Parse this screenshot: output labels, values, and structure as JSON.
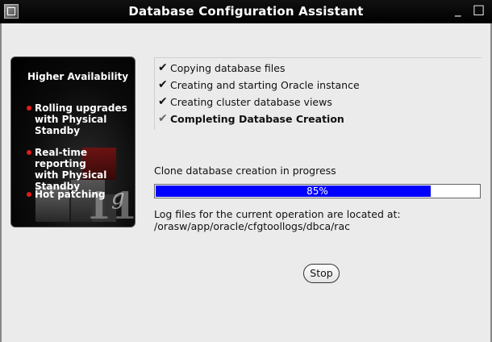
{
  "window": {
    "title": "Database Configuration Assistant",
    "minimize_glyph": "_",
    "maximize_glyph": "□"
  },
  "promo": {
    "heading": "Higher Availability",
    "items": [
      {
        "label": "Rolling upgrades\nwith Physical\nStandby"
      },
      {
        "label": "Real-time reporting\nwith Physical\nStandby"
      },
      {
        "label": "Hot patching"
      }
    ],
    "accent_color": "#e21b1b"
  },
  "steps": [
    {
      "label": "Copying database files",
      "status": "done",
      "icon": "check-icon",
      "mark": "✔"
    },
    {
      "label": "Creating and starting Oracle instance",
      "status": "done",
      "icon": "check-icon",
      "mark": "✔"
    },
    {
      "label": "Creating cluster database views",
      "status": "done",
      "icon": "check-icon",
      "mark": "✔"
    },
    {
      "label": "Completing Database Creation",
      "status": "in_progress",
      "icon": "pending-check-icon",
      "mark": "✔"
    }
  ],
  "progress": {
    "label": "Clone database creation in progress",
    "percent_text": "85%",
    "value": 0.85,
    "fill_color": "#0000ff"
  },
  "log": {
    "line1": "Log files for the current operation are located at:",
    "line2": "/orasw/app/oracle/cfgtoollogs/dbca/rac"
  },
  "actions": {
    "stop_label": "Stop"
  }
}
